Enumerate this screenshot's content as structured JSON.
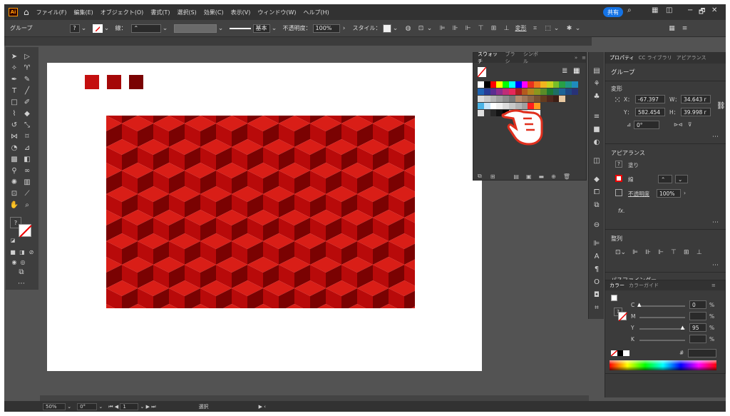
{
  "menubar": {
    "logo": "Ai",
    "items": [
      "ファイル(F)",
      "編集(E)",
      "オブジェクト(O)",
      "書式(T)",
      "選択(S)",
      "効果(C)",
      "表示(V)",
      "ウィンドウ(W)",
      "ヘルプ(H)"
    ],
    "share_label": "共有",
    "window_controls": [
      "−",
      "🗗",
      "✕"
    ]
  },
  "control_bar": {
    "selection_label": "グループ",
    "stroke_label": "線：",
    "stroke_style": "基本",
    "opacity_label": "不透明度：",
    "opacity_value": "100%",
    "style_label": "スタイル：",
    "transform_label": "変形"
  },
  "swatches_panel": {
    "tabs": [
      "スウォッチ",
      "ブラシ",
      "シンボル"
    ]
  },
  "properties_panel": {
    "tabs": [
      "プロパティ",
      "CC ライブラリ",
      "アピアランス"
    ],
    "selection_type": "グループ",
    "transform": {
      "title": "変形",
      "x_label": "X：",
      "x_value": "-67.397",
      "y_label": "Y：",
      "y_value": "582.454",
      "w_label": "W：",
      "w_value": "34.643 r",
      "h_label": "H：",
      "h_value": "39.998 r",
      "angle_value": "0°"
    },
    "appearance": {
      "title": "アピアランス",
      "fill_label": "塗り",
      "stroke_label": "線",
      "opacity_label": "不透明度",
      "opacity_value": "100%",
      "fx_label": "fx."
    },
    "align": {
      "title": "整列"
    },
    "pathfinder": {
      "title": "パスファインダー"
    }
  },
  "color_panel": {
    "tabs": [
      "カラー",
      "カラーガイド"
    ],
    "channels": [
      {
        "label": "C",
        "value": "0",
        "unit": "%",
        "level": 0
      },
      {
        "label": "M",
        "value": "",
        "unit": "%",
        "level": 0
      },
      {
        "label": "Y",
        "value": "95",
        "unit": "%",
        "level": 0.95
      },
      {
        "label": "K",
        "value": "",
        "unit": "%",
        "level": 0
      }
    ]
  },
  "status_bar": {
    "zoom": "50%",
    "rotation": "0°",
    "artboard_number": "1",
    "tool_name": "選択"
  },
  "colors": {
    "cube_top": "#d91e17",
    "cube_left": "#b80a0a",
    "cube_right": "#7a0202",
    "accent": "#1473e6"
  }
}
